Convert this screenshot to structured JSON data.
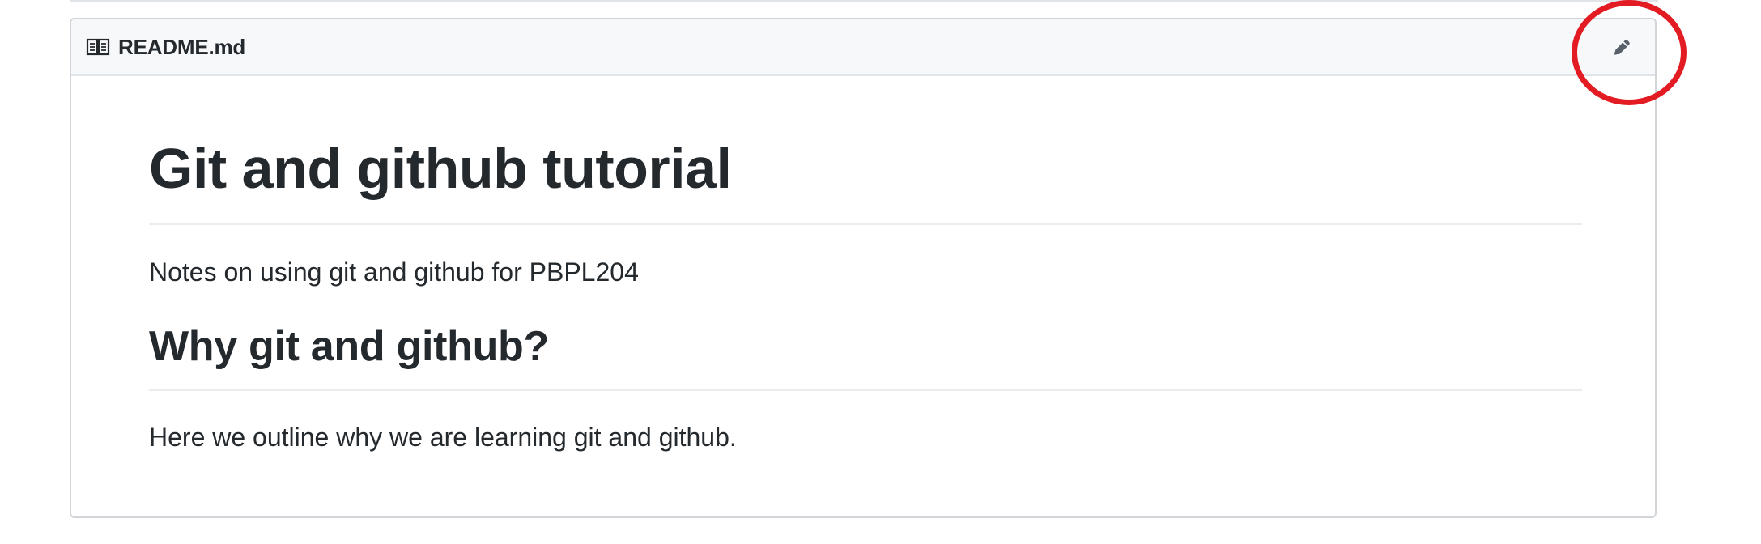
{
  "readme": {
    "file_name": "README.md",
    "title": "Git and github tutorial",
    "description": "Notes on using git and github for PBPL204",
    "section_heading": "Why git and github?",
    "section_text": "Here we outline why we are learning git and github."
  },
  "icons": {
    "file_icon": "book-icon",
    "edit_icon": "pencil-icon",
    "annotation": "red-circle-highlight"
  },
  "colors": {
    "text": "#24292e",
    "header_background": "#f6f8fa",
    "border": "#d1d5da",
    "highlight": "#e31b23"
  }
}
